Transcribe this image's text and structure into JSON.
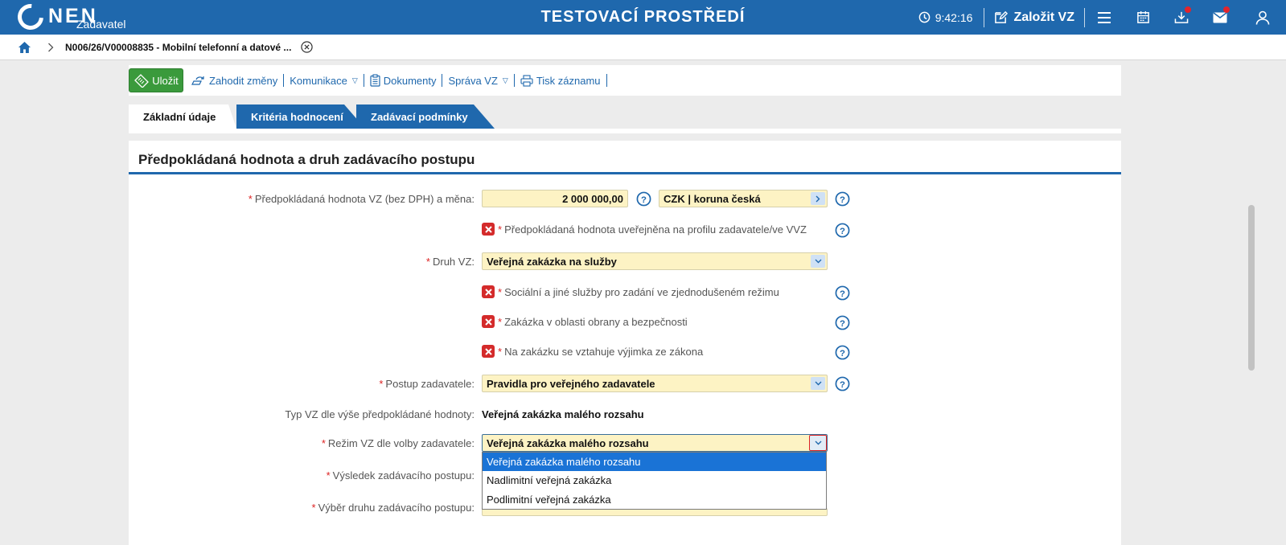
{
  "topbar": {
    "logo": "NEN",
    "logo_sub": "Zadavatel",
    "env_title": "TESTOVACÍ PROSTŘEDÍ",
    "time": "9:42:16",
    "new_vz": "Založit VZ",
    "icons": [
      "clock-icon",
      "edit-icon",
      "menu-icon",
      "calendar-icon",
      "download-icon",
      "mail-icon",
      "user-icon"
    ]
  },
  "breadcrumb": {
    "text": "N006/26/V00008835 - Mobilní telefonní a datové ..."
  },
  "toolbar": {
    "save": "Uložit",
    "discard": "Zahodit změny",
    "communication": "Komunikace",
    "documents": "Dokumenty",
    "manage": "Správa VZ",
    "print": "Tisk záznamu"
  },
  "tabs": [
    {
      "label": "Základní údaje",
      "active": true
    },
    {
      "label": "Kritéria hodnocení",
      "active": false
    },
    {
      "label": "Zadávací podmínky",
      "active": false
    }
  ],
  "panel": {
    "title": "Předpokládaná hodnota a druh zadávacího postupu",
    "fields": {
      "value_label": "Předpokládaná hodnota VZ (bez DPH) a měna:",
      "value": "2 000 000,00",
      "currency": "CZK | koruna česká",
      "published_label": "Předpokládaná hodnota uveřejněna na profilu zadavatele/ve VVZ",
      "type_label": "Druh VZ:",
      "type_value": "Veřejná zakázka na služby",
      "social_label": "Sociální a jiné služby pro zadání ve zjednodušeném režimu",
      "defense_label": "Zakázka v oblasti obrany a bezpečnosti",
      "exemption_label": "Na zakázku se vztahuje výjimka ze zákona",
      "procedure_label": "Postup zadavatele:",
      "procedure_value": "Pravidla pro veřejného zadavatele",
      "size_type_label": "Typ VZ dle výše předpokládané hodnoty:",
      "size_type_value": "Veřejná zakázka malého rozsahu",
      "regime_label": "Režim VZ dle volby zadavatele:",
      "regime_value": "Veřejná zakázka malého rozsahu",
      "result_label": "Výsledek zadávacího postupu:",
      "choice_label": "Výběr druhu zadávacího postupu:"
    },
    "regime_options": [
      "Veřejná zakázka malého rozsahu",
      "Nadlimitní veřejná zakázka",
      "Podlimitní veřejná zakázka"
    ]
  }
}
